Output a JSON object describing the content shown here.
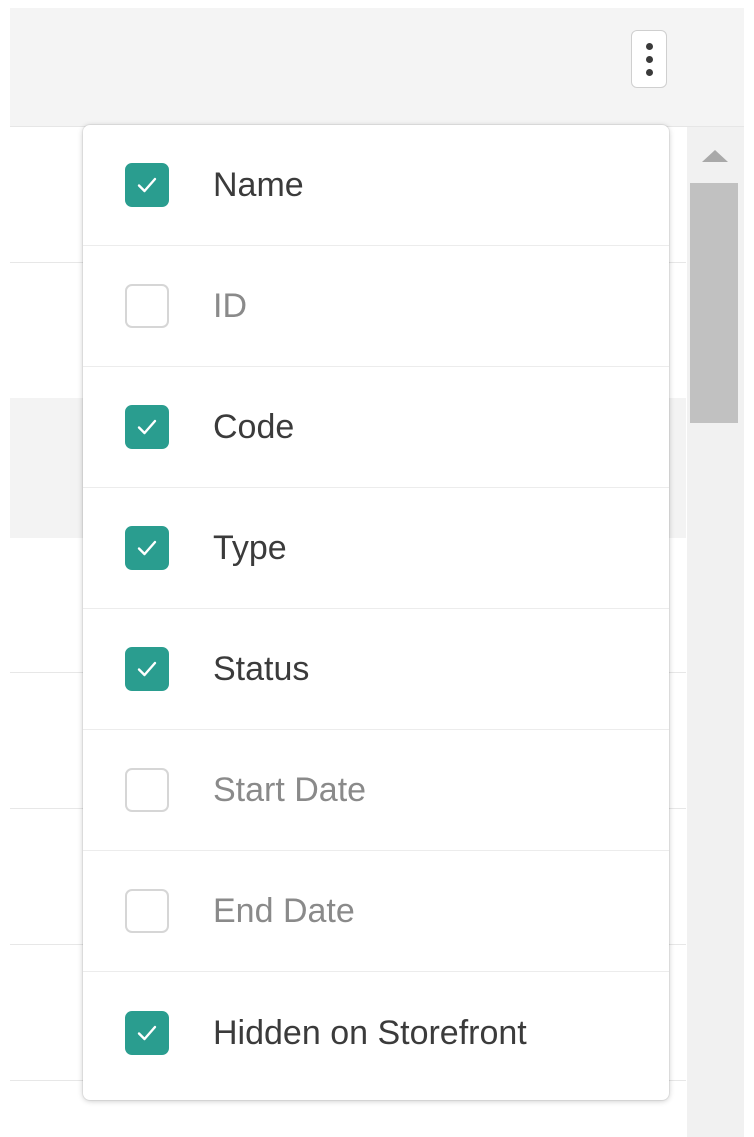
{
  "toolbar": {
    "more_options_icon": "kebab-vertical-icon"
  },
  "column_menu": {
    "accent_color": "#2a9d8f",
    "items": [
      {
        "label": "Name",
        "checked": true
      },
      {
        "label": "ID",
        "checked": false
      },
      {
        "label": "Code",
        "checked": true
      },
      {
        "label": "Type",
        "checked": true
      },
      {
        "label": "Status",
        "checked": true
      },
      {
        "label": "Start Date",
        "checked": false
      },
      {
        "label": "End Date",
        "checked": false
      },
      {
        "label": "Hidden on Storefront",
        "checked": true
      }
    ]
  },
  "scrollbar": {
    "up_arrow_icon": "triangle-up-icon"
  }
}
